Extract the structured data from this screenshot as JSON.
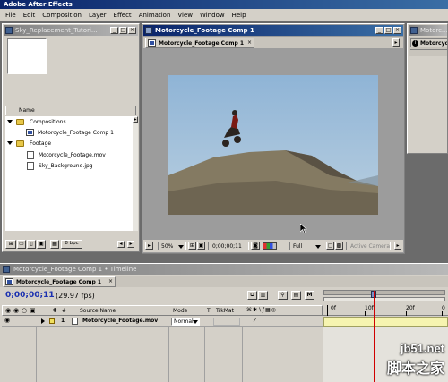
{
  "app": {
    "title": "Adobe After Effects"
  },
  "menu": [
    "File",
    "Edit",
    "Composition",
    "Layer",
    "Effect",
    "Animation",
    "View",
    "Window",
    "Help"
  ],
  "project": {
    "title": "Sky_Replacement_Tutori...",
    "column_name": "Name",
    "items": [
      {
        "kind": "folder",
        "label": "Compositions",
        "level": 0
      },
      {
        "kind": "comp",
        "label": "Motorcycle_Footage Comp 1",
        "level": 1
      },
      {
        "kind": "folder",
        "label": "Footage",
        "level": 0
      },
      {
        "kind": "footage",
        "label": "Motorcycle_Footage.mov",
        "level": 1
      },
      {
        "kind": "footage",
        "label": "Sky_Background.jpg",
        "level": 1
      }
    ],
    "bpc": "8 bpc"
  },
  "comp_window": {
    "title": "Motorcycle_Footage Comp 1",
    "tab": "Motorcycle_Footage Comp 1",
    "zoom": "50%",
    "timecode": "0;00;00;11",
    "resolution": "Full",
    "camera": "Active Camera"
  },
  "right_panel": {
    "title": "Motorc...",
    "tab": "Motorcyc..."
  },
  "timeline": {
    "title": "Motorcycle_Footage Comp 1 • Timeline",
    "tab": "Motorcycle_Footage Comp 1",
    "timecode": "0;00;00;11",
    "fps": "(29.97 fps)",
    "headers": {
      "num": "#",
      "source": "Source Name",
      "mode": "Mode",
      "t": "T",
      "trkmat": "TrkMat"
    },
    "layer": {
      "num": "1",
      "source": "Motorcycle_Footage.mov",
      "mode": "Normal"
    },
    "ruler_labels": [
      "0f",
      "10f",
      "20f",
      "0"
    ]
  },
  "watermark": {
    "site": "jb51.net",
    "cn": "脚本之家"
  },
  "colors": {
    "title_active": "#0a246a",
    "panel": "#d4d0c8",
    "layer_bar": "#f6f4b0",
    "cti": "#d00000"
  }
}
